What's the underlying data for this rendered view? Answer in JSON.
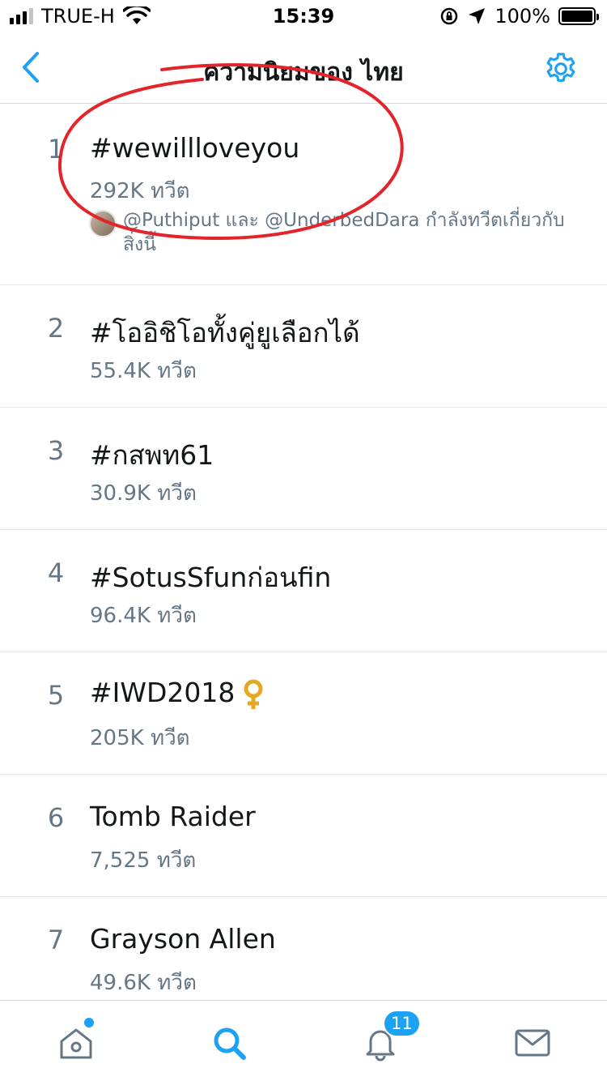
{
  "status_bar": {
    "carrier": "TRUE-H",
    "time": "15:39",
    "battery": "100%"
  },
  "header": {
    "title": "ความนิยมของ ไทย",
    "back_icon": "chevron-left-icon",
    "settings_icon": "gear-icon"
  },
  "trends": [
    {
      "rank": "1",
      "name": "#wewillloveyou",
      "count": "292K ทวีต",
      "context": "@Puthiput และ @UnderbedDara กำลังทวีตเกี่ยวกับสิ่งนี้"
    },
    {
      "rank": "2",
      "name": "#โออิชิโอทั้งคู่ยูเลือกได้",
      "count": "55.4K ทวีต"
    },
    {
      "rank": "3",
      "name": "#กสพท61",
      "count": "30.9K ทวีต"
    },
    {
      "rank": "4",
      "name": "#SotusSfunก่อนfin",
      "count": "96.4K ทวีต"
    },
    {
      "rank": "5",
      "name": "#IWD2018",
      "count": "205K ทวีต",
      "emoji": "venus-icon"
    },
    {
      "rank": "6",
      "name": "Tomb Raider",
      "count": "7,525 ทวีต"
    },
    {
      "rank": "7",
      "name": "Grayson Allen",
      "count": "49.6K ทวีต"
    }
  ],
  "tabbar": {
    "tabs": [
      "home-icon",
      "search-icon",
      "notifications-icon",
      "messages-icon"
    ],
    "active": "search-icon",
    "notifications_badge": "11"
  },
  "colors": {
    "accent": "#1da1f2",
    "secondary_text": "#657786",
    "annotation": "#e3242b"
  }
}
